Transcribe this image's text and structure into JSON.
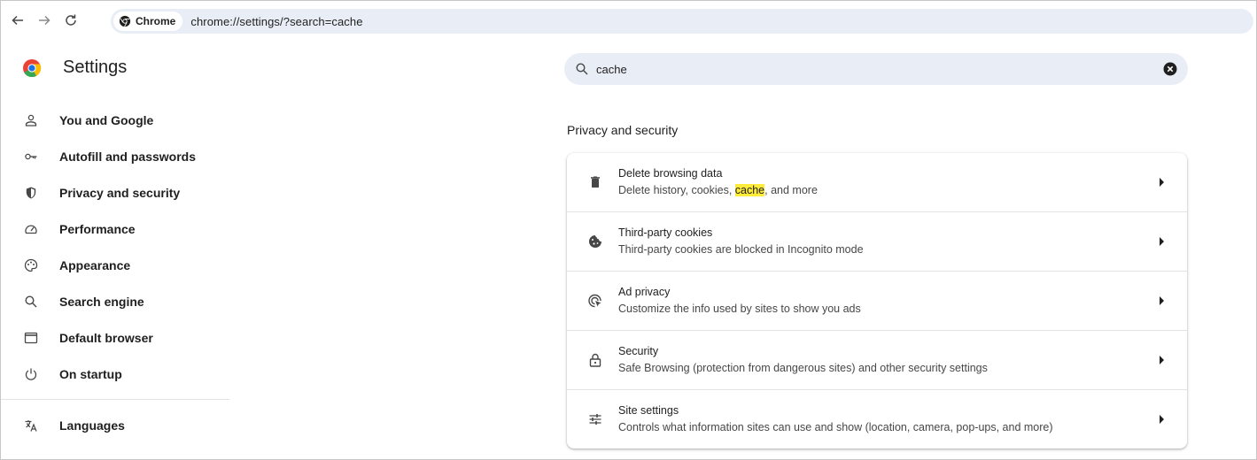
{
  "browser": {
    "chip_label": "Chrome",
    "url": "chrome://settings/?search=cache"
  },
  "app": {
    "title": "Settings"
  },
  "sidebar": {
    "items": [
      {
        "label": "You and Google",
        "icon": "person-icon"
      },
      {
        "label": "Autofill and passwords",
        "icon": "key-icon"
      },
      {
        "label": "Privacy and security",
        "icon": "shield-icon"
      },
      {
        "label": "Performance",
        "icon": "speedometer-icon"
      },
      {
        "label": "Appearance",
        "icon": "palette-icon"
      },
      {
        "label": "Search engine",
        "icon": "search-icon"
      },
      {
        "label": "Default browser",
        "icon": "browser-window-icon"
      },
      {
        "label": "On startup",
        "icon": "power-icon"
      },
      {
        "label": "Languages",
        "icon": "translate-icon"
      }
    ]
  },
  "search": {
    "value": "cache"
  },
  "section": {
    "title": "Privacy and security"
  },
  "rows": [
    {
      "title": "Delete browsing data",
      "sub_before": "Delete history, cookies, ",
      "sub_highlight": "cache",
      "sub_after": ", and more",
      "icon": "trash-icon"
    },
    {
      "title": "Third-party cookies",
      "sub": "Third-party cookies are blocked in Incognito mode",
      "icon": "cookie-icon"
    },
    {
      "title": "Ad privacy",
      "sub": "Customize the info used by sites to show you ads",
      "icon": "ad-privacy-icon"
    },
    {
      "title": "Security",
      "sub": "Safe Browsing (protection from dangerous sites) and other security settings",
      "icon": "lock-icon"
    },
    {
      "title": "Site settings",
      "sub": "Controls what information sites can use and show (location, camera, pop-ups, and more)",
      "icon": "sliders-icon"
    }
  ],
  "colors": {
    "accent_bg": "#e9eef6",
    "highlight": "#ffeb3b"
  }
}
